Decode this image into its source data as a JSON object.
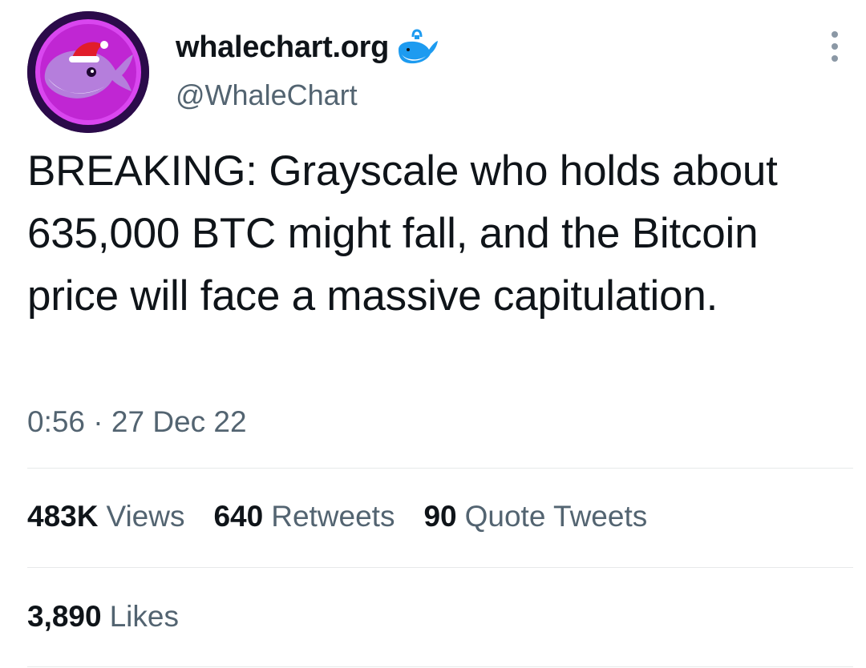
{
  "author": {
    "display_name": "whalechart.org",
    "handle": "@WhaleChart",
    "avatar_icon": "whale-santa-hat-avatar",
    "badge_icon": "whale-icon",
    "avatar_colors": {
      "ring": "#2b0b4a",
      "bg": "#d946ef",
      "whale": "#b57edc"
    }
  },
  "menu": {
    "icon": "more-vertical-icon"
  },
  "tweet": {
    "text": "BREAKING: Grayscale who holds about 635,000 BTC might fall, and the Bitcoin price will face a massive capitulation."
  },
  "meta": {
    "time": "0:56",
    "separator": "·",
    "date": "27 Dec 22"
  },
  "stats": {
    "views": {
      "count": "483K",
      "label": "Views"
    },
    "retweets": {
      "count": "640",
      "label": "Retweets"
    },
    "quote_tweets": {
      "count": "90",
      "label": "Quote Tweets"
    },
    "likes": {
      "count": "3,890",
      "label": "Likes"
    }
  },
  "colors": {
    "primary_text": "#0f1419",
    "secondary_text": "#536471",
    "divider": "#e7e9ea",
    "badge_blue": "#1d9bf0"
  }
}
